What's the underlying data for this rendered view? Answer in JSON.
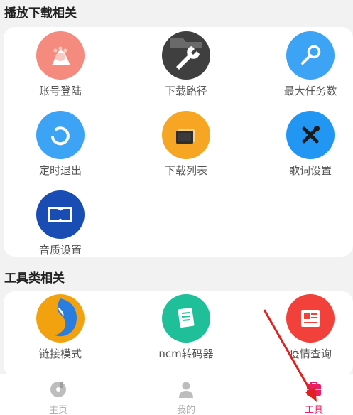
{
  "sections": [
    {
      "title": "播放下载相关",
      "items": [
        {
          "label": "账号登陆",
          "icon": "paw-icon",
          "color": "#f58a7f"
        },
        {
          "label": "下载路径",
          "icon": "wrench-folder-icon",
          "color": "#3f3f3f"
        },
        {
          "label": "最大任务数",
          "icon": "wrench-icon",
          "color": "#3da3f5"
        },
        {
          "label": "定时退出",
          "icon": "refresh-icon",
          "color": "#3da3f5"
        },
        {
          "label": "下载列表",
          "icon": "cards-icon",
          "color": "#f6a623"
        },
        {
          "label": "歌词设置",
          "icon": "tools-icon",
          "color": "#2196f3"
        },
        {
          "label": "音质设置",
          "icon": "dolby-icon",
          "color": "#1a4db3"
        }
      ]
    },
    {
      "title": "工具类相关",
      "items": [
        {
          "label": "链接模式",
          "icon": "firefox-icon",
          "color": "#f2a20f"
        },
        {
          "label": "ncm转码器",
          "icon": "document-icon",
          "color": "#1fbf9a"
        },
        {
          "label": "疫情查询",
          "icon": "news-icon",
          "color": "#f2403a"
        }
      ]
    }
  ],
  "bottom_nav": [
    {
      "label": "主页",
      "icon": "disc-icon",
      "active": false
    },
    {
      "label": "我的",
      "icon": "person-icon",
      "active": false
    },
    {
      "label": "工具",
      "icon": "tools-nav-icon",
      "active": true
    }
  ],
  "colors": {
    "active_tab": "#e91e63",
    "inactive_tab": "#b0b0b0",
    "annotation_arrow": "#e0201c"
  }
}
